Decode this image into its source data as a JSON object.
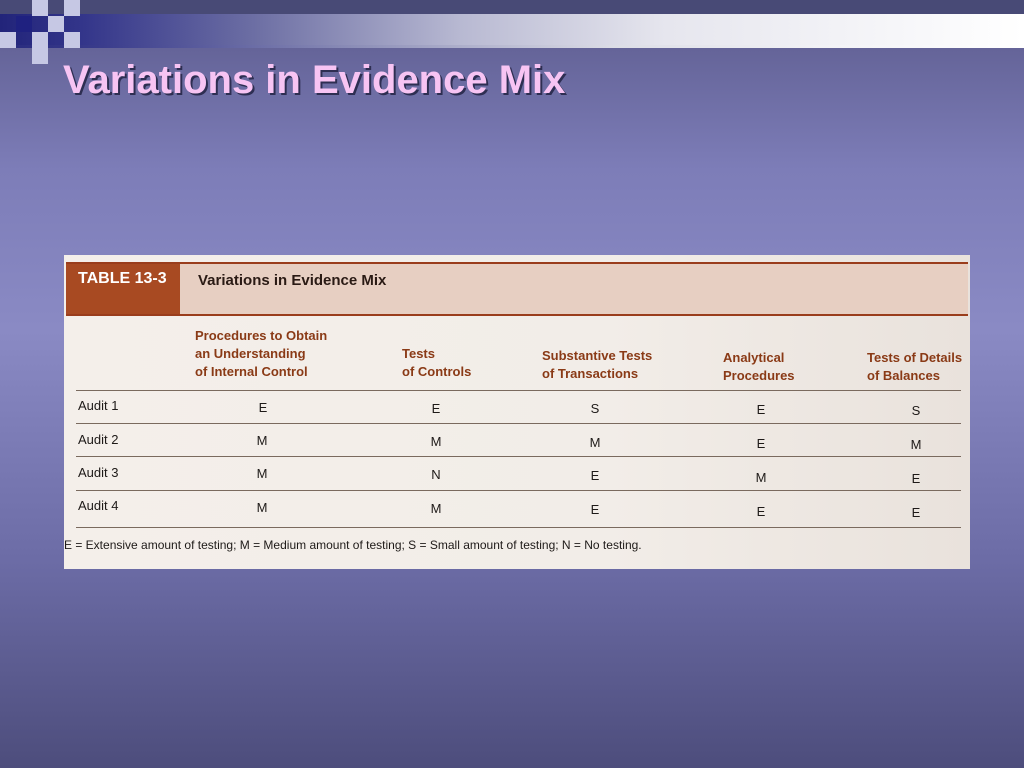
{
  "slide": {
    "title": "Variations in Evidence Mix"
  },
  "table": {
    "number": "TABLE 13-3",
    "title": "Variations in Evidence Mix",
    "columns": [
      [
        "Procedures to Obtain",
        "an Understanding",
        "of Internal Control"
      ],
      [
        "Tests",
        "of Controls"
      ],
      [
        "Substantive Tests",
        "of Transactions"
      ],
      [
        "Analytical",
        "Procedures"
      ],
      [
        "Tests of Details",
        "of Balances"
      ]
    ],
    "rows": [
      {
        "label": "Audit 1",
        "cells": [
          "E",
          "E",
          "S",
          "E",
          "S"
        ]
      },
      {
        "label": "Audit 2",
        "cells": [
          "M",
          "M",
          "M",
          "E",
          "M"
        ]
      },
      {
        "label": "Audit 3",
        "cells": [
          "M",
          "N",
          "E",
          "M",
          "E"
        ]
      },
      {
        "label": "Audit 4",
        "cells": [
          "M",
          "M",
          "E",
          "E",
          "E"
        ]
      }
    ],
    "legend": "E = Extensive amount of testing; M = Medium amount of testing; S = Small amount of testing; N = No testing."
  },
  "colors": {
    "title_text": "#f7c4f3",
    "table_number_bg": "#a84a22",
    "header_text": "#8a3a16",
    "square_dark": "#1f2180",
    "square_light": "#c6c8e4"
  }
}
